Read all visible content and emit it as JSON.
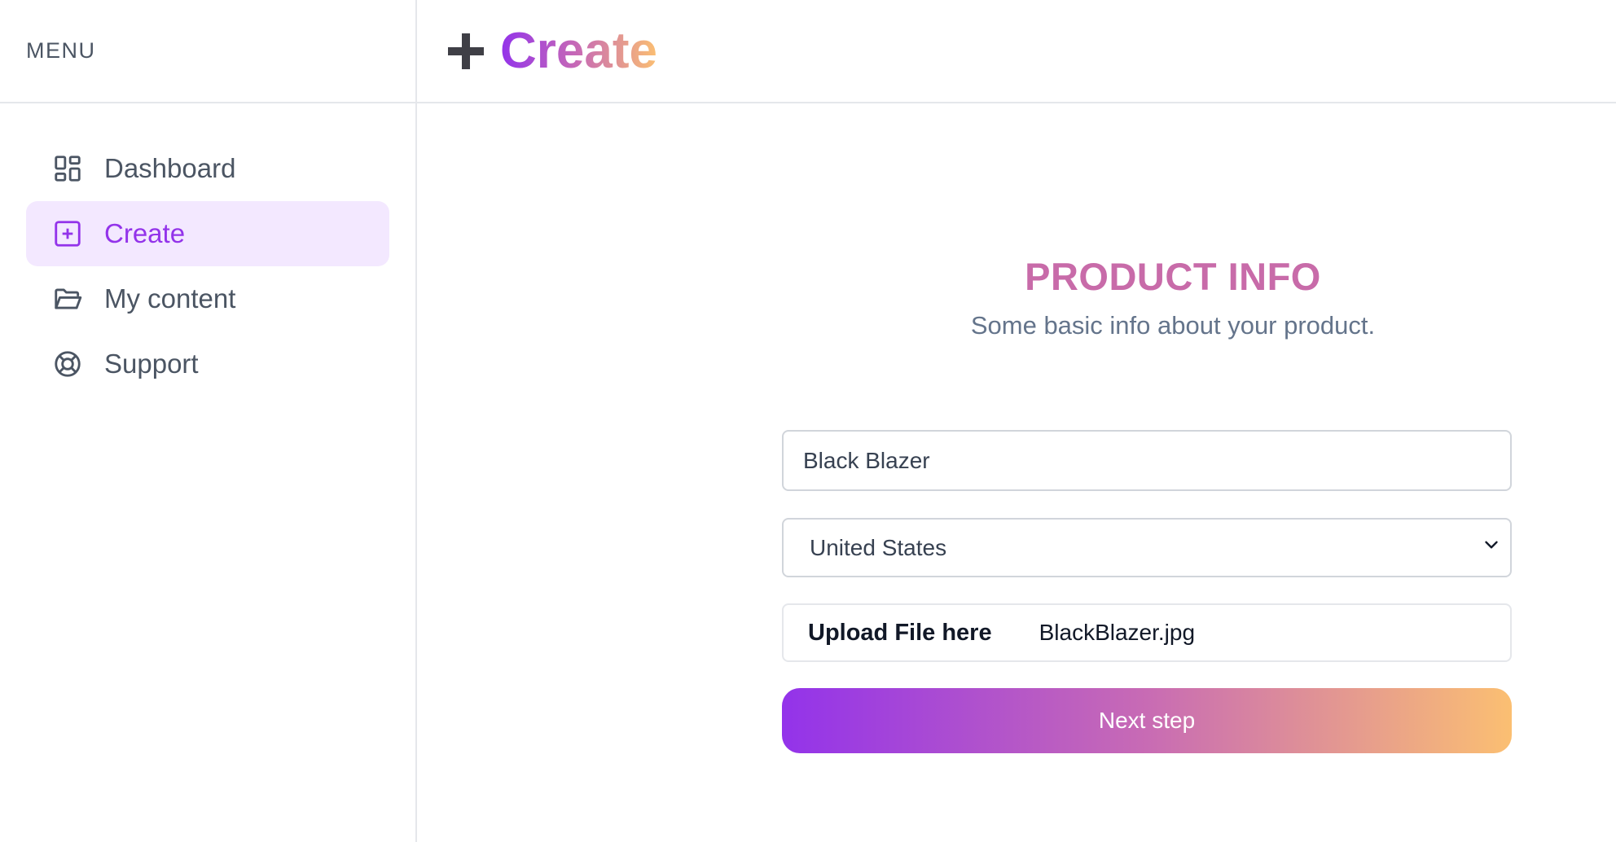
{
  "sidebar": {
    "menu_label": "MENU",
    "items": [
      {
        "label": "Dashboard",
        "icon": "dashboard-grid-icon",
        "active": false
      },
      {
        "label": "Create",
        "icon": "plus-square-icon",
        "active": true
      },
      {
        "label": "My content",
        "icon": "folder-open-icon",
        "active": false
      },
      {
        "label": "Support",
        "icon": "lifebuoy-icon",
        "active": false
      }
    ]
  },
  "header": {
    "title": "Create",
    "icon": "plus-icon"
  },
  "form": {
    "heading": "PRODUCT INFO",
    "subheading": "Some basic info about your product.",
    "product_name": {
      "value": "Black Blazer"
    },
    "country": {
      "selected": "United States"
    },
    "file": {
      "button_label": "Upload File here",
      "file_name": "BlackBlazer.jpg"
    },
    "next_label": "Next step"
  },
  "colors": {
    "accent": "#9333ea",
    "active_bg": "#f3e8ff",
    "gradient_start": "#9333ea",
    "gradient_mid": "#c86bb4",
    "gradient_end": "#fbbf72",
    "heading": "#c86ba9"
  }
}
